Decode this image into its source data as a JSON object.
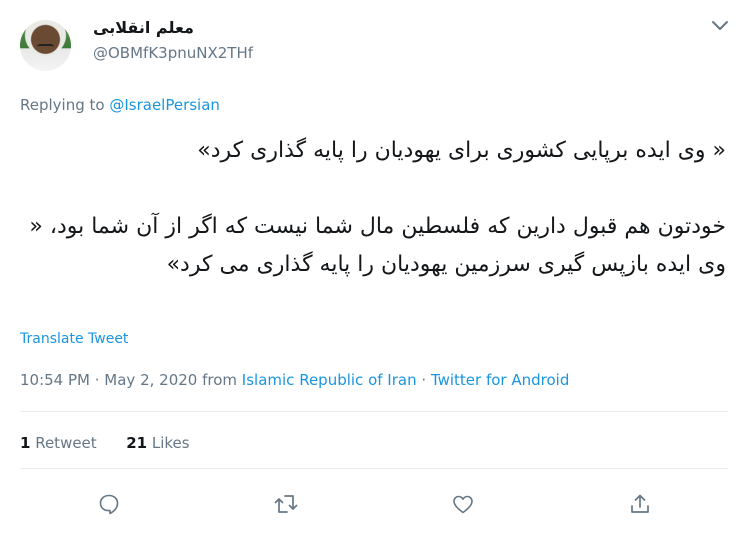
{
  "author": {
    "display_name": "معلم انقلابی",
    "handle": "@OBMfK3pnuNX2THf"
  },
  "reply": {
    "prefix": "Replying to ",
    "target": "@IsraelPersian"
  },
  "tweet": {
    "text": "« وی ایده برپایی کشوری برای یهودیان را پایه گذاری کرد»\n\nخودتون هم قبول دارین که فلسطین مال شما نیست که اگر از آن شما بود، « وی ایده بازپس گیری سرزمین یهودیان را پایه گذاری می کرد»"
  },
  "translate_label": "Translate Tweet",
  "meta": {
    "time": "10:54 PM",
    "sep1": " · ",
    "date": "May 2, 2020",
    "from_word": " from ",
    "location": "Islamic Republic of Iran",
    "sep2": " · ",
    "source": "Twitter for Android"
  },
  "stats": {
    "retweets_count": "1",
    "retweets_label": " Retweet",
    "likes_count": "21",
    "likes_label": " Likes"
  },
  "colors": {
    "link": "#1b95e0",
    "secondary_text": "#657786",
    "divider": "#e6ecf0"
  },
  "icons": {
    "caret": "chevron-down-icon",
    "reply": "reply-icon",
    "retweet": "retweet-icon",
    "like": "heart-icon",
    "share": "share-icon"
  }
}
